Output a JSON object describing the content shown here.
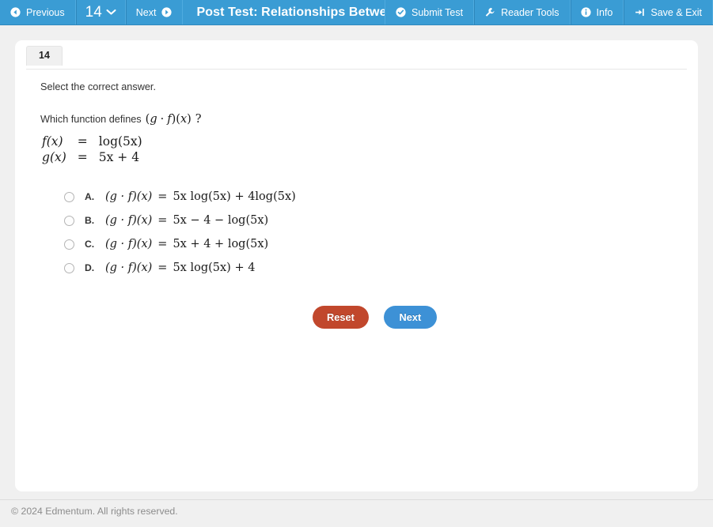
{
  "toolbar": {
    "previous_label": "Previous",
    "previous_icon": "circle-arrow-left-icon",
    "question_number": "14",
    "question_number_icon": "chevron-down-icon",
    "next_label": "Next",
    "next_icon": "circle-arrow-right-icon",
    "title": "Post Test: Relationships Between F",
    "right_items": [
      {
        "label": "Submit Test",
        "icon": "check-circle-icon"
      },
      {
        "label": "Reader Tools",
        "icon": "wrench-icon"
      },
      {
        "label": "Info",
        "icon": "info-circle-icon"
      },
      {
        "label": "Save & Exit",
        "icon": "sign-out-icon"
      }
    ]
  },
  "question": {
    "tab_number": "14",
    "prompt": "Select the correct answer.",
    "stem_text": "Which function defines",
    "stem_math_open": "(",
    "stem_math_g": "g",
    "stem_math_dot": "·",
    "stem_math_f": "f",
    "stem_math_close": ")(",
    "stem_math_x": "x",
    "stem_math_end": ")",
    "stem_question_mark": "?",
    "definitions": [
      {
        "lhs_fn": "f",
        "lhs_arg": "(x)",
        "eq": "=",
        "rhs": "log(5x)"
      },
      {
        "lhs_fn": "g",
        "lhs_arg": "(x)",
        "eq": "=",
        "rhs": "5x + 4"
      }
    ],
    "options": [
      {
        "letter": "A.",
        "expr_lhs": "(g · f)(x)",
        "expr_eq": "=",
        "expr_rhs": "5x log(5x) + 4log(5x)",
        "selected": false
      },
      {
        "letter": "B.",
        "expr_lhs": "(g · f)(x)",
        "expr_eq": "=",
        "expr_rhs": "5x − 4 − log(5x)",
        "selected": false
      },
      {
        "letter": "C.",
        "expr_lhs": "(g · f)(x)",
        "expr_eq": "=",
        "expr_rhs": "5x + 4 + log(5x)",
        "selected": false
      },
      {
        "letter": "D.",
        "expr_lhs": "(g · f)(x)",
        "expr_eq": "=",
        "expr_rhs": "5x log(5x) + 4",
        "selected": false
      }
    ]
  },
  "actions": {
    "reset_label": "Reset",
    "next_label": "Next"
  },
  "footer": {
    "copyright": "© 2024 Edmentum. All rights reserved."
  },
  "colors": {
    "toolbar_blue": "#3a9cd4",
    "page_background": "#f0f0f0",
    "card_background": "#ffffff",
    "reset_red": "#c1472c",
    "next_blue": "#3d91d6",
    "footer_text": "#8c8c8c"
  }
}
